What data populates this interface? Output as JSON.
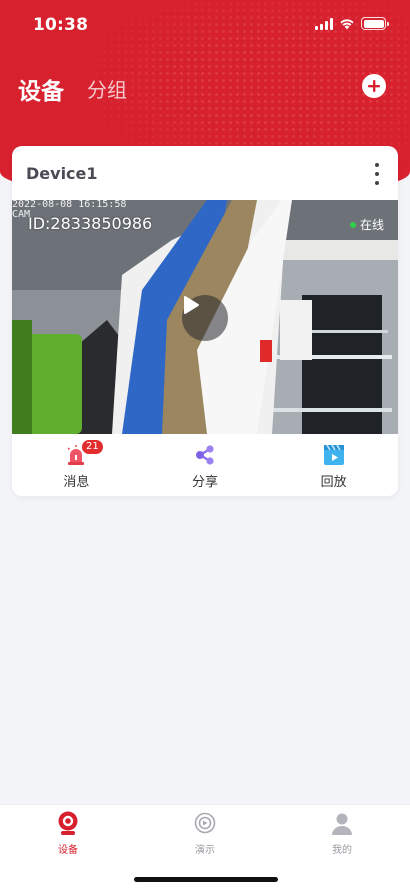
{
  "status_bar": {
    "time": "10:38"
  },
  "header": {
    "title": "设备",
    "tab_group": "分组"
  },
  "colors": {
    "brand_red": "#d8212e",
    "online_green": "#2fd14a",
    "badge_red": "#e12d2d"
  },
  "device_card": {
    "name": "Device1",
    "device_id": "ID:2833850986",
    "status": "在线",
    "osd_timestamp": "2022-08-08  16:15:58",
    "osd_sub": "CAM",
    "actions": [
      {
        "label": "消息",
        "icon": "alarm-light-icon",
        "badge": "21"
      },
      {
        "label": "分享",
        "icon": "share-icon"
      },
      {
        "label": "回放",
        "icon": "playback-clapper-icon"
      }
    ]
  },
  "tabbar": {
    "items": [
      {
        "label": "设备",
        "icon": "camera-icon",
        "active": true
      },
      {
        "label": "演示",
        "icon": "demo-circle-icon",
        "active": false
      },
      {
        "label": "我的",
        "icon": "user-icon",
        "active": false
      }
    ]
  }
}
